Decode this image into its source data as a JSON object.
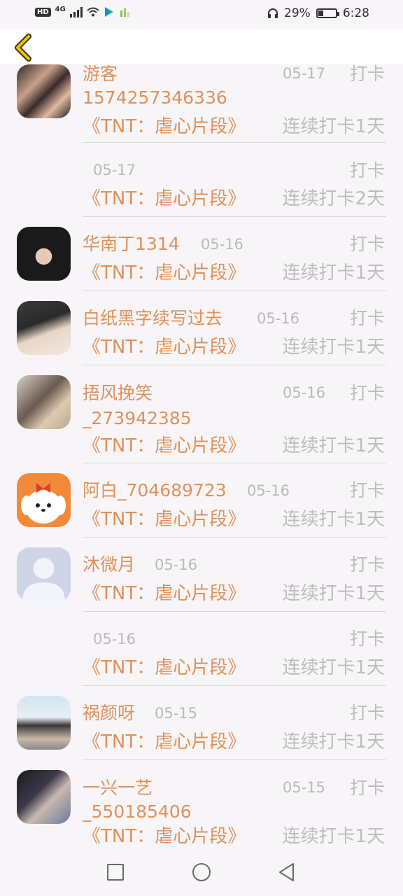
{
  "status_bar": {
    "network_hd": "HD",
    "network_type": "4G",
    "battery_percent": "29%",
    "time": "6:28"
  },
  "header": {
    "back_icon": "chevron-left-icon",
    "accent": "#f2c200"
  },
  "entries": [
    {
      "has_avatar": true,
      "name_line1": "游客",
      "name_line2": "1574257346336",
      "date": "05-17",
      "action": "打卡",
      "course": "《TNT：虐心片段》",
      "streak": "连续打卡1天"
    },
    {
      "has_avatar": false,
      "name_line1": "",
      "date": "05-17",
      "action": "打卡",
      "course": "《TNT：虐心片段》",
      "streak": "连续打卡2天"
    },
    {
      "has_avatar": true,
      "name_line1": "华南丁1314",
      "date": "05-16",
      "action": "打卡",
      "course": "《TNT：虐心片段》",
      "streak": "连续打卡1天"
    },
    {
      "has_avatar": true,
      "name_line1": "白纸黑字续写过去",
      "date": "05-16",
      "action": "打卡",
      "course": "《TNT：虐心片段》",
      "streak": "连续打卡1天"
    },
    {
      "has_avatar": true,
      "name_line1": "捂风挽笑",
      "name_line2": "_273942385",
      "date": "05-16",
      "action": "打卡",
      "course": "《TNT：虐心片段》",
      "streak": "连续打卡1天"
    },
    {
      "has_avatar": true,
      "name_line1": "阿白_704689723",
      "date": "05-16",
      "action": "打卡",
      "course": "《TNT：虐心片段》",
      "streak": "连续打卡1天"
    },
    {
      "has_avatar": true,
      "name_line1": "沐微月",
      "date": "05-16",
      "action": "打卡",
      "course": "《TNT：虐心片段》",
      "streak": "连续打卡1天"
    },
    {
      "has_avatar": false,
      "name_line1": "",
      "date": "05-16",
      "action": "打卡",
      "course": "《TNT：虐心片段》",
      "streak": "连续打卡1天"
    },
    {
      "has_avatar": true,
      "name_line1": "祸颜呀",
      "date": "05-15",
      "action": "打卡",
      "course": "《TNT：虐心片段》",
      "streak": "连续打卡1天"
    },
    {
      "has_avatar": true,
      "name_line1": "一兴一艺",
      "name_line2": "_550185406",
      "date": "05-15",
      "action": "打卡",
      "course": "《TNT：虐心片段》",
      "streak": "连续打卡1天"
    }
  ],
  "nav_bar": {
    "recent_icon": "square-icon",
    "home_icon": "circle-icon",
    "back_icon": "triangle-back-icon"
  },
  "colors": {
    "name": "#e0915a",
    "muted": "#bdbdbd",
    "divider": "#d9d9d9"
  }
}
